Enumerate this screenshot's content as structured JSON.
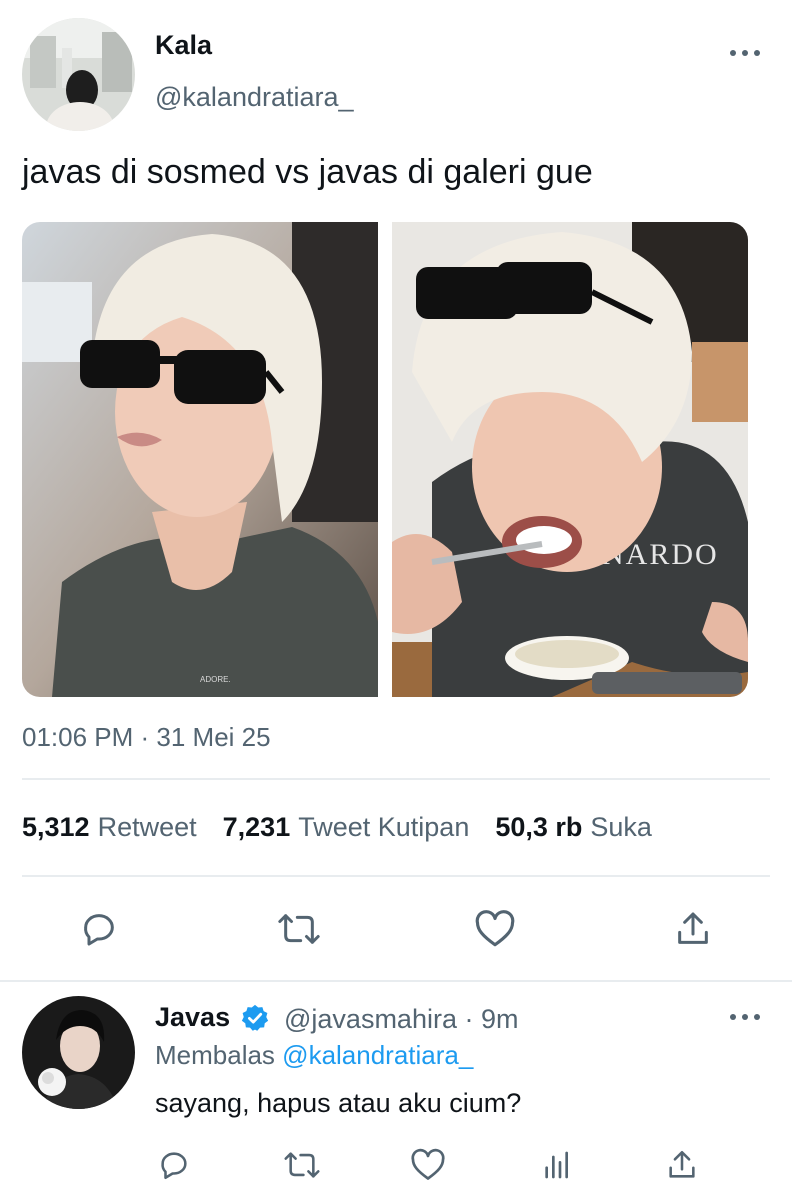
{
  "tweet": {
    "author_name": "Kala",
    "author_handle": "@kalandratiara_",
    "text": "javas di sosmed vs javas di galeri gue",
    "timestamp": "01:06 PM · 31 Mei 25",
    "images": [
      {
        "description": "blond man wearing black sunglasses",
        "watermark": "ADORE."
      },
      {
        "description": "blond man eating with spoon, sunglasses on head",
        "shirt_text": "NARDO"
      }
    ],
    "stats": {
      "retweets": {
        "value": "5,312",
        "label": "Retweet"
      },
      "quotes": {
        "value": "7,231",
        "label": "Tweet Kutipan"
      },
      "likes": {
        "value": "50,3 rb",
        "label": "Suka"
      }
    },
    "actions": [
      "reply-icon",
      "retweet-icon",
      "like-icon",
      "share-icon"
    ]
  },
  "reply": {
    "author_name": "Javas",
    "author_handle_time": "@javasmahira · 9m",
    "replying_label": "Membalas",
    "replying_to": "@kalandratiara_",
    "text": "sayang, hapus atau aku cium?",
    "actions": [
      "reply-icon",
      "retweet-icon",
      "like-icon",
      "views-icon",
      "share-icon"
    ]
  },
  "colors": {
    "text": "#0f1419",
    "secondary": "#536471",
    "accent": "#1d9bf0",
    "divider": "#e8ecef"
  }
}
